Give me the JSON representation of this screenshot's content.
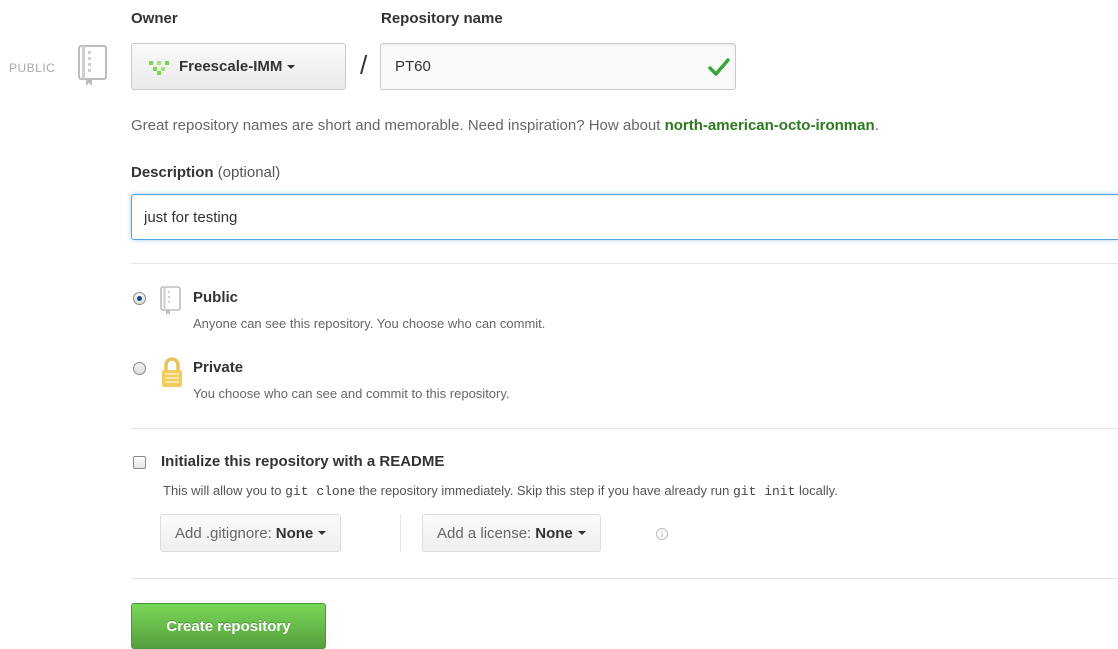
{
  "owner": {
    "label": "Owner",
    "selected": "Freescale-IMM"
  },
  "repo": {
    "label": "Repository name",
    "value": "PT60",
    "separator": "/"
  },
  "visibility_badge": "PUBLIC",
  "hint": {
    "text": "Great repository names are short and memorable. Need inspiration? How about ",
    "suggestion": "north-american-octo-ironman",
    "suffix": "."
  },
  "description": {
    "label": "Description",
    "optional": "(optional)",
    "value": "just for testing"
  },
  "visibility": {
    "selected": "public",
    "options": [
      {
        "id": "public",
        "title": "Public",
        "desc": "Anyone can see this repository. You choose who can commit."
      },
      {
        "id": "private",
        "title": "Private",
        "desc": "You choose who can see and commit to this repository."
      }
    ]
  },
  "readme": {
    "checked": false,
    "title": "Initialize this repository with a README",
    "desc_1": "This will allow you to ",
    "code_1": "git clone",
    "desc_2": " the repository immediately. Skip this step if you have already run ",
    "code_2": "git init",
    "desc_3": " locally."
  },
  "gitignore": {
    "label": "Add .gitignore:",
    "value": "None"
  },
  "license": {
    "label": "Add a license:",
    "value": "None"
  },
  "info_icon": "i",
  "submit_label": "Create repository",
  "colors": {
    "accent_green": "#2d7a1e",
    "button_green": "#6cc644",
    "focus_blue": "#51a7e8"
  },
  "icons": [
    "repo-book-icon",
    "check-icon",
    "caret-down-icon",
    "lock-icon",
    "info-icon",
    "owner-avatar-icon"
  ]
}
